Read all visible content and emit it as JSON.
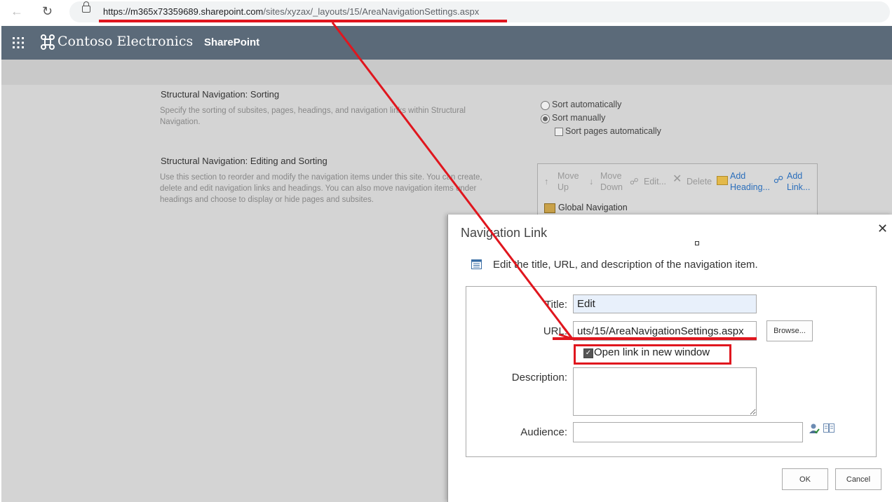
{
  "browser": {
    "url_host": "https://m365x73359689.sharepoint.com",
    "url_path": "/sites/xyzax/_layouts/15/AreaNavigationSettings.aspx"
  },
  "suite": {
    "brand": "Contoso Electronics",
    "app": "SharePoint"
  },
  "page": {
    "sorting": {
      "title": "Structural Navigation: Sorting",
      "description": "Specify the sorting of subsites, pages, headings, and navigation links within Structural Navigation.",
      "options": [
        "Sort automatically",
        "Sort manually"
      ],
      "selected": "Sort manually",
      "sub_option": "Sort pages automatically"
    },
    "editing": {
      "title": "Structural Navigation: Editing and Sorting",
      "description": "Use this section to reorder and modify the navigation items under this site. You can create, delete and edit navigation links and headings. You can also move navigation items under headings and choose to display or hide pages and subsites.",
      "toolbar": {
        "move_up": "Move Up",
        "move_down": "Move Down",
        "edit": "Edit...",
        "delete": "Delete",
        "add_heading": "Add Heading...",
        "add_link": "Add Link..."
      },
      "tree_root": "Global Navigation"
    }
  },
  "dialog": {
    "title": "Navigation Link",
    "intro": "Edit the title, URL, and description of the navigation item.",
    "title_label": "Title:",
    "title_value": "Edit",
    "url_label": "URL:",
    "url_value": "uts/15/AreaNavigationSettings.aspx",
    "browse_label": "Browse...",
    "open_new_window_label": "Open link in new window",
    "open_new_window_checked": true,
    "description_label": "Description:",
    "description_value": "",
    "audience_label": "Audience:",
    "audience_value": "",
    "ok_label": "OK",
    "cancel_label": "Cancel"
  },
  "colors": {
    "suite_bar": "#5b6a79",
    "annotation_red": "#e0161e",
    "title_input_bg": "#e8f0fb"
  }
}
